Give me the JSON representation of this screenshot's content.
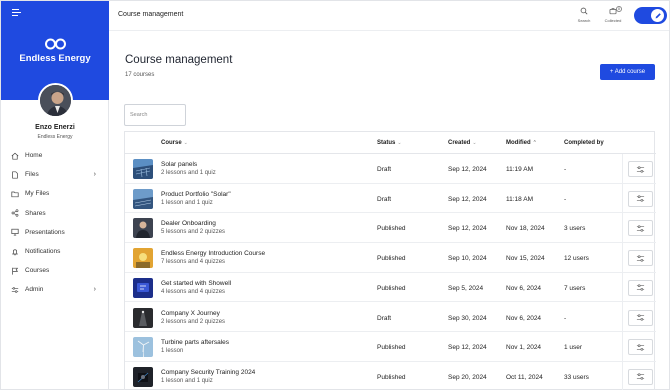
{
  "brand": {
    "name": "Endless Energy",
    "color": "#1f4ae0"
  },
  "user": {
    "name": "Enzo Enerzi",
    "org": "Endless Energy"
  },
  "sidebar": {
    "items": [
      {
        "label": "Home",
        "icon": "home-icon",
        "has_submenu": false
      },
      {
        "label": "Files",
        "icon": "file-icon",
        "has_submenu": true
      },
      {
        "label": "My Files",
        "icon": "folder-icon",
        "has_submenu": false
      },
      {
        "label": "Shares",
        "icon": "share-icon",
        "has_submenu": false
      },
      {
        "label": "Presentations",
        "icon": "monitor-icon",
        "has_submenu": false
      },
      {
        "label": "Notifications",
        "icon": "bell-icon",
        "has_submenu": false
      },
      {
        "label": "Courses",
        "icon": "flag-icon",
        "has_submenu": false
      },
      {
        "label": "Admin",
        "icon": "sliders-icon",
        "has_submenu": true
      }
    ]
  },
  "header": {
    "title": "Course management",
    "search_label": "Search",
    "collected_label": "Collected",
    "collected_count": "0"
  },
  "main": {
    "title": "Course management",
    "subtitle": "17 courses",
    "add_button": "+ Add course",
    "search_placeholder": "Search",
    "columns": {
      "course": "Course",
      "status": "Status",
      "created": "Created",
      "modified": "Modified",
      "completed": "Completed by"
    },
    "rows": [
      {
        "name": "Solar panels",
        "meta": "2 lessons and 1 quiz",
        "status": "Draft",
        "created": "Sep 12, 2024",
        "modified": "11:19 AM",
        "completed": "-"
      },
      {
        "name": "Product Portfolio \"Solar\"",
        "meta": "1 lesson and 1 quiz",
        "status": "Draft",
        "created": "Sep 12, 2024",
        "modified": "11:18 AM",
        "completed": "-"
      },
      {
        "name": "Dealer Onboarding",
        "meta": "5 lessons and 2 quizzes",
        "status": "Published",
        "created": "Sep 12, 2024",
        "modified": "Nov 18, 2024",
        "completed": "3 users"
      },
      {
        "name": "Endless Energy Introduction Course",
        "meta": "7 lessons and 4 quizzes",
        "status": "Published",
        "created": "Sep 10, 2024",
        "modified": "Nov 15, 2024",
        "completed": "12 users"
      },
      {
        "name": "Get started with Showell",
        "meta": "4 lessons and 4 quizzes",
        "status": "Published",
        "created": "Sep 5, 2024",
        "modified": "Nov 6, 2024",
        "completed": "7 users"
      },
      {
        "name": "Company X Journey",
        "meta": "2 lessons and 2 quizzes",
        "status": "Draft",
        "created": "Sep 30, 2024",
        "modified": "Nov 6, 2024",
        "completed": "-"
      },
      {
        "name": "Turbine parts aftersales",
        "meta": "1 lesson",
        "status": "Published",
        "created": "Sep 12, 2024",
        "modified": "Nov 1, 2024",
        "completed": "1 user"
      },
      {
        "name": "Company Security Training 2024",
        "meta": "1 lesson and 1 quiz",
        "status": "Published",
        "created": "Sep 20, 2024",
        "modified": "Oct 11, 2024",
        "completed": "33 users"
      }
    ]
  }
}
